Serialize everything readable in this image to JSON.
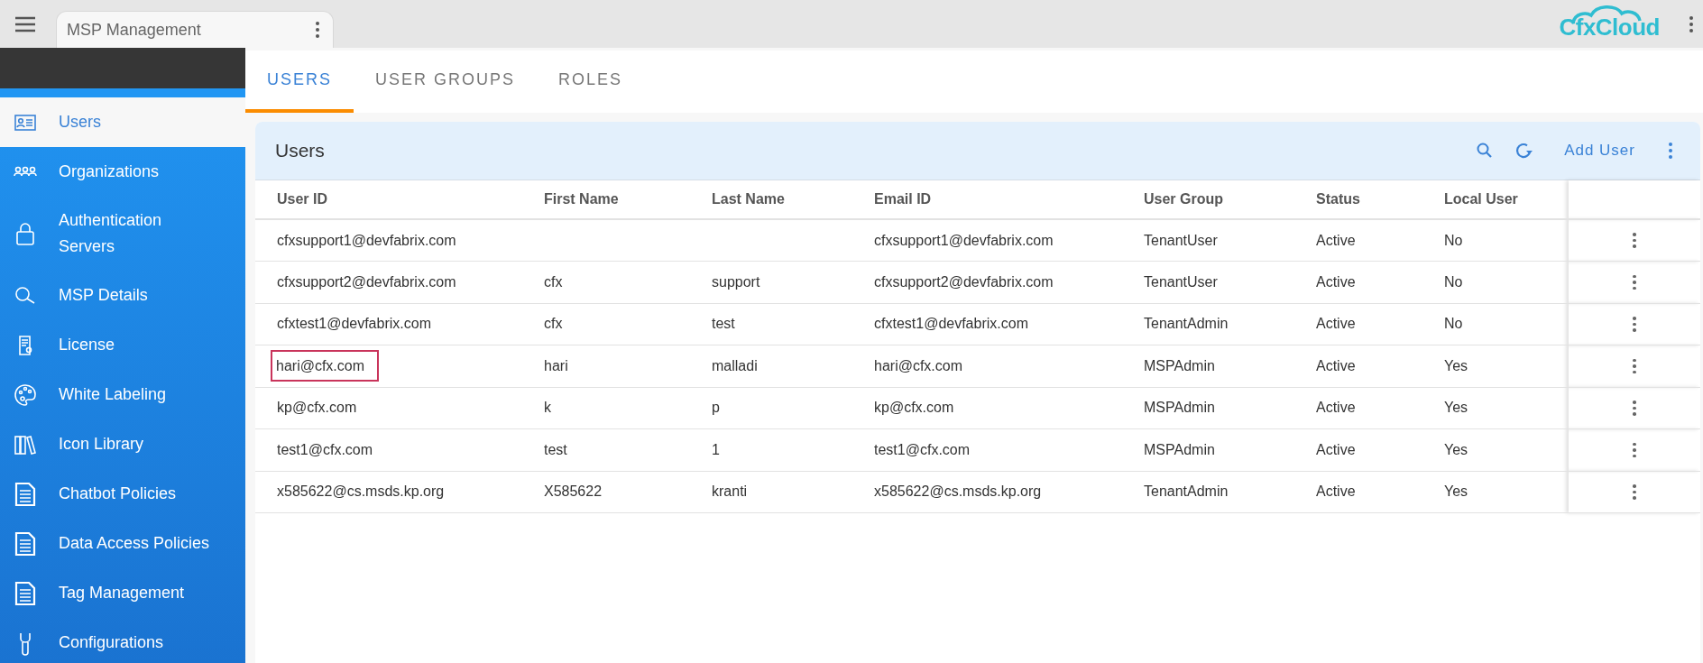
{
  "app_tab": {
    "title": "MSP Management"
  },
  "logo": {
    "text": "CfxCloud"
  },
  "sidebar": {
    "items": [
      {
        "label": "Users",
        "selected": true
      },
      {
        "label": "Organizations",
        "selected": false
      },
      {
        "label": "Authentication Servers",
        "selected": false
      },
      {
        "label": "MSP Details",
        "selected": false
      },
      {
        "label": "License",
        "selected": false
      },
      {
        "label": "White Labeling",
        "selected": false
      },
      {
        "label": "Icon Library",
        "selected": false
      },
      {
        "label": "Chatbot Policies",
        "selected": false
      },
      {
        "label": "Data Access Policies",
        "selected": false
      },
      {
        "label": "Tag Management",
        "selected": false
      },
      {
        "label": "Configurations",
        "selected": false
      }
    ]
  },
  "tabs": [
    {
      "label": "USERS",
      "selected": true
    },
    {
      "label": "USER GROUPS",
      "selected": false
    },
    {
      "label": "ROLES",
      "selected": false
    }
  ],
  "card": {
    "title": "Users",
    "add_button": "Add User"
  },
  "table": {
    "columns": [
      "User ID",
      "First Name",
      "Last Name",
      "Email ID",
      "User Group",
      "Status",
      "Local User"
    ],
    "rows": [
      {
        "cells": [
          "cfxsupport1@devfabrix.com",
          "",
          "",
          "cfxsupport1@devfabrix.com",
          "TenantUser",
          "Active",
          "No"
        ],
        "highlighted": false
      },
      {
        "cells": [
          "cfxsupport2@devfabrix.com",
          "cfx",
          "support",
          "cfxsupport2@devfabrix.com",
          "TenantUser",
          "Active",
          "No"
        ],
        "highlighted": false
      },
      {
        "cells": [
          "cfxtest1@devfabrix.com",
          "cfx",
          "test",
          "cfxtest1@devfabrix.com",
          "TenantAdmin",
          "Active",
          "No"
        ],
        "highlighted": false
      },
      {
        "cells": [
          "hari@cfx.com",
          "hari",
          "malladi",
          "hari@cfx.com",
          "MSPAdmin",
          "Active",
          "Yes"
        ],
        "highlighted": true
      },
      {
        "cells": [
          "kp@cfx.com",
          "k",
          "p",
          "kp@cfx.com",
          "MSPAdmin",
          "Active",
          "Yes"
        ],
        "highlighted": false
      },
      {
        "cells": [
          "test1@cfx.com",
          "test",
          "1",
          "test1@cfx.com",
          "MSPAdmin",
          "Active",
          "Yes"
        ],
        "highlighted": false
      },
      {
        "cells": [
          "x585622@cs.msds.kp.org",
          "X585622",
          "kranti",
          "x585622@cs.msds.kp.org",
          "TenantAdmin",
          "Active",
          "Yes"
        ],
        "highlighted": false
      }
    ]
  }
}
